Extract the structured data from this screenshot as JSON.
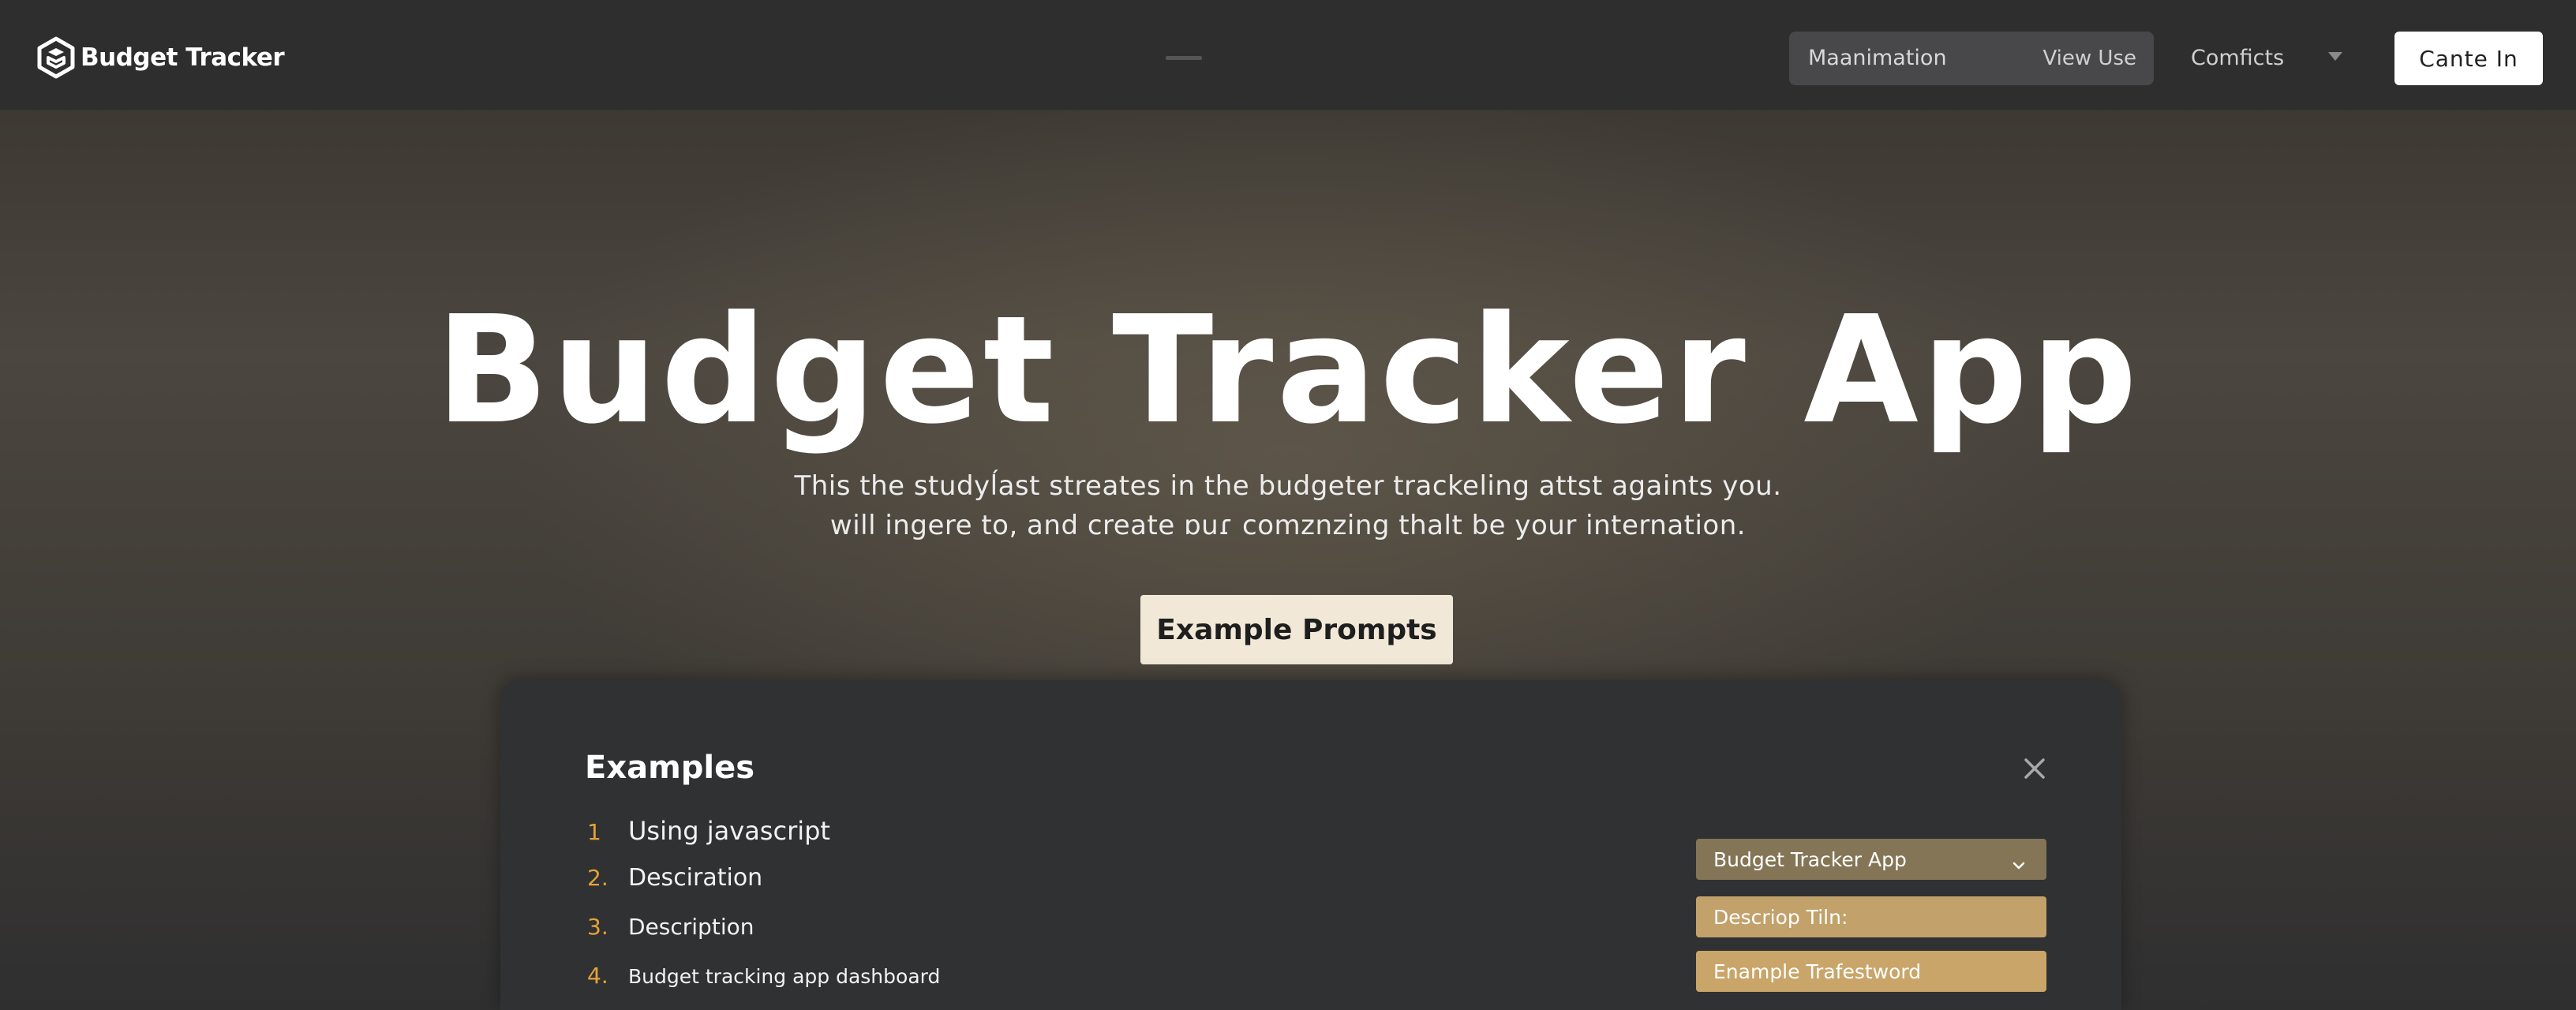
{
  "header": {
    "brand": "Budget Tracker",
    "brand_icon": "hexagon-logo-icon",
    "search_placeholder": "Maanimation",
    "view_use_label": "View Use",
    "conflicts_label": "Comficts",
    "signin_label": "Cante In"
  },
  "hero": {
    "title": "Budget Tracker App",
    "subtitle_line1": "This the studyĺast streates in the budgeter trackeling attst againts you.",
    "subtitle_line2": "will ingere to, and create ɒuɾ comznzing thalt be your internation.",
    "cta_label": "Example Prompts"
  },
  "examples": {
    "title": "Examples",
    "items": [
      {
        "num": "1",
        "text": "Using javascript"
      },
      {
        "num": "2.",
        "text": "Desciration"
      },
      {
        "num": "3.",
        "text": "Description"
      },
      {
        "num": "4.",
        "text": "Budget tracking app dashboard"
      }
    ],
    "dropdown_selected": "Budget Tracker App",
    "option_1": "Descriop Tiln:",
    "option_2": "Enample Trafestword"
  },
  "colors": {
    "accent_number": "#e6a23a",
    "cta_background": "#f1e8d8",
    "dropdown_dark": "#847556",
    "dropdown_light": "#c2a16a"
  }
}
